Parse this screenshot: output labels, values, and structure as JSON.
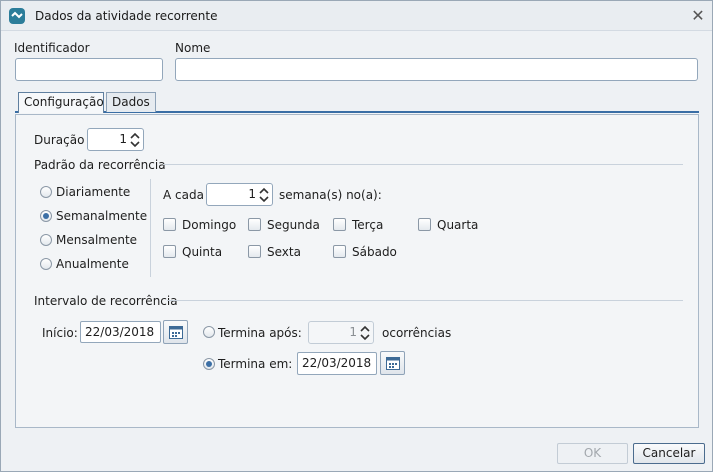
{
  "window": {
    "title": "Dados da atividade recorrente",
    "close_glyph": "✕",
    "icon": "app-logo-icon"
  },
  "fields": {
    "identificador_label": "Identificador",
    "identificador_value": "",
    "nome_label": "Nome",
    "nome_value": ""
  },
  "tabs": [
    {
      "label": "Configuração",
      "active": true
    },
    {
      "label": "Dados",
      "active": false
    }
  ],
  "config": {
    "duracao_label": "Duração",
    "duracao_value": "1",
    "padrao_title": "Padrão da recorrência",
    "patterns": [
      {
        "label": "Diariamente",
        "checked": false
      },
      {
        "label": "Semanalmente",
        "checked": true
      },
      {
        "label": "Mensalmente",
        "checked": false
      },
      {
        "label": "Anualmente",
        "checked": false
      }
    ],
    "a_cada_label": "A cada",
    "a_cada_value": "1",
    "semanas_label": "semana(s) no(a):",
    "days": [
      {
        "label": "Domingo",
        "checked": false
      },
      {
        "label": "Segunda",
        "checked": false
      },
      {
        "label": "Terça",
        "checked": false
      },
      {
        "label": "Quarta",
        "checked": false
      },
      {
        "label": "Quinta",
        "checked": false
      },
      {
        "label": "Sexta",
        "checked": false
      },
      {
        "label": "Sábado",
        "checked": false
      }
    ],
    "intervalo_title": "Intervalo de recorrência",
    "inicio_label": "Início:",
    "inicio_value": "22/03/2018",
    "termina_apos_label": "Termina após:",
    "termina_apos_value": "1",
    "termina_apos_checked": false,
    "ocorrencias_label": "ocorrências",
    "termina_em_label": "Termina em:",
    "termina_em_value": "22/03/2018",
    "termina_em_checked": true
  },
  "buttons": {
    "ok_label": "OK",
    "cancelar_label": "Cancelar"
  },
  "colors": {
    "accent": "#3c6fa5",
    "window_bg": "#eef1f4",
    "panel_bg": "#f3f5f7"
  }
}
